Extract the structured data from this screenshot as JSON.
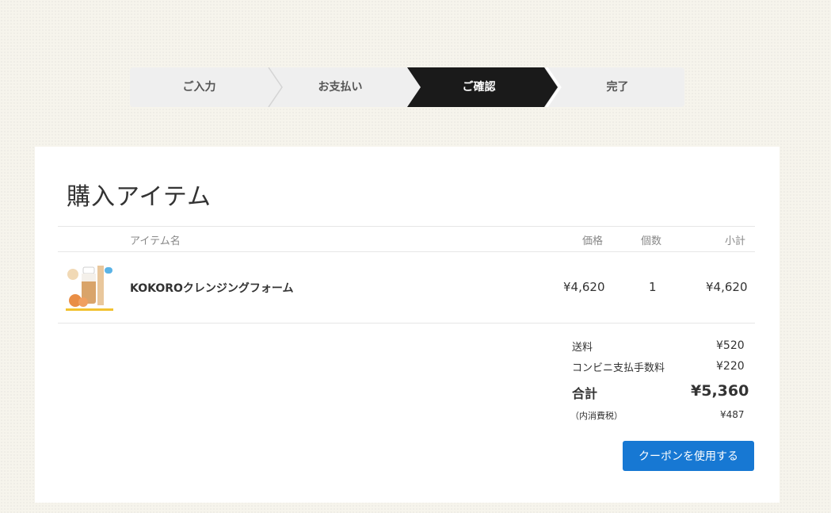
{
  "steps": [
    {
      "label": "ご入力"
    },
    {
      "label": "お支払い"
    },
    {
      "label": "ご確認"
    },
    {
      "label": "完了"
    }
  ],
  "colors": {
    "active_step": "#1a1a1a",
    "step_bg": "#efefef",
    "button": "#1778d3"
  },
  "section": {
    "title": "購入アイテム"
  },
  "table": {
    "headers": {
      "name": "アイテム名",
      "price": "価格",
      "qty": "個数",
      "subtotal": "小計"
    },
    "items": [
      {
        "name": "KOKOROクレンジングフォーム",
        "price": "¥4,620",
        "qty": "1",
        "subtotal": "¥4,620"
      }
    ]
  },
  "summary": {
    "shipping_label": "送料",
    "shipping": "¥520",
    "fee_label": "コンビニ支払手数料",
    "fee": "¥220",
    "total_label": "合計",
    "total": "¥5,360",
    "tax_label": "（内消費税）",
    "tax": "¥487"
  },
  "coupon_label": "クーポンを使用する"
}
